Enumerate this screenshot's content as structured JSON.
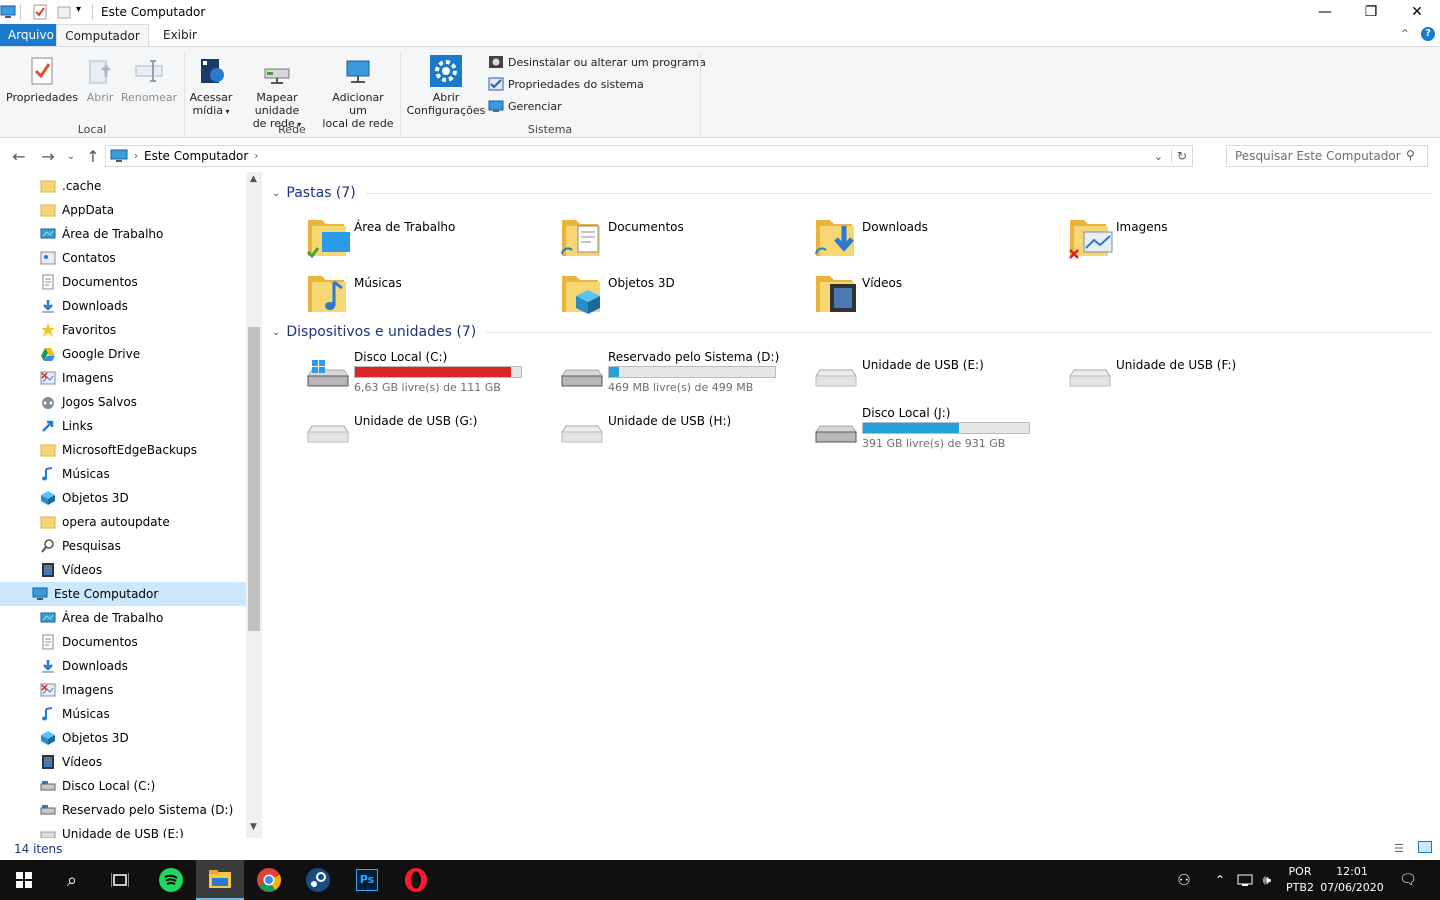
{
  "window": {
    "title": "Este Computador",
    "minimize": "—",
    "maximize": "❐",
    "close": "✕"
  },
  "ribbon_tabs": {
    "file": "Arquivo",
    "computer": "Computador",
    "view": "Exibir"
  },
  "ribbon": {
    "properties": "Propriedades",
    "open": "Abrir",
    "rename": "Renomear",
    "access_media_1": "Acessar",
    "access_media_2": "mídia",
    "map_drive_1": "Mapear unidade",
    "map_drive_2": "de rede",
    "add_location_1": "Adicionar um",
    "add_location_2": "local de rede",
    "open_settings_1": "Abrir",
    "open_settings_2": "Configurações",
    "uninstall": "Desinstalar ou alterar um programa",
    "system_properties": "Propriedades do sistema",
    "manage": "Gerenciar",
    "group_local": "Local",
    "group_network": "Rede",
    "group_system": "Sistema"
  },
  "address": {
    "path": "Este Computador",
    "search_placeholder": "Pesquisar Este Computador"
  },
  "nav_items": [
    {
      "label": ".cache",
      "icon": "folder-icon"
    },
    {
      "label": "AppData",
      "icon": "folder-icon"
    },
    {
      "label": "Área de Trabalho",
      "icon": "desktop-icon"
    },
    {
      "label": "Contatos",
      "icon": "contacts-icon"
    },
    {
      "label": "Documentos",
      "icon": "documents-icon"
    },
    {
      "label": "Downloads",
      "icon": "downloads-icon"
    },
    {
      "label": "Favoritos",
      "icon": "star-icon"
    },
    {
      "label": "Google Drive",
      "icon": "google-drive-icon"
    },
    {
      "label": "Imagens",
      "icon": "pictures-icon"
    },
    {
      "label": "Jogos Salvos",
      "icon": "saved-games-icon"
    },
    {
      "label": "Links",
      "icon": "links-icon"
    },
    {
      "label": "MicrosoftEdgeBackups",
      "icon": "folder-icon"
    },
    {
      "label": "Músicas",
      "icon": "music-icon"
    },
    {
      "label": "Objetos 3D",
      "icon": "3d-objects-icon"
    },
    {
      "label": "opera autoupdate",
      "icon": "folder-icon"
    },
    {
      "label": "Pesquisas",
      "icon": "search-icon"
    },
    {
      "label": "Vídeos",
      "icon": "videos-icon"
    },
    {
      "label": "Este Computador",
      "icon": "computer-icon"
    },
    {
      "label": "Área de Trabalho",
      "icon": "desktop-icon"
    },
    {
      "label": "Documentos",
      "icon": "documents-icon"
    },
    {
      "label": "Downloads",
      "icon": "downloads-icon"
    },
    {
      "label": "Imagens",
      "icon": "pictures-icon"
    },
    {
      "label": "Músicas",
      "icon": "music-icon"
    },
    {
      "label": "Objetos 3D",
      "icon": "3d-objects-icon"
    },
    {
      "label": "Vídeos",
      "icon": "videos-icon"
    },
    {
      "label": "Disco Local (C:)",
      "icon": "drive-icon"
    },
    {
      "label": "Reservado pelo Sistema (D:)",
      "icon": "drive-icon"
    },
    {
      "label": "Unidade de USB (E:)",
      "icon": "usb-drive-icon"
    }
  ],
  "sections": {
    "folders": "Pastas (7)",
    "devices": "Dispositivos e unidades (7)"
  },
  "folders": [
    {
      "label": "Área de Trabalho"
    },
    {
      "label": "Documentos"
    },
    {
      "label": "Downloads"
    },
    {
      "label": "Imagens"
    },
    {
      "label": "Músicas"
    },
    {
      "label": "Objetos 3D"
    },
    {
      "label": "Vídeos"
    }
  ],
  "drives": [
    {
      "label": "Disco Local (C:)",
      "space": "6,63 GB livre(s) de 111 GB",
      "used_fraction": 0.94,
      "critical": true
    },
    {
      "label": "Reservado pelo Sistema (D:)",
      "space": "469 MB livre(s) de 499 MB",
      "used_fraction": 0.06,
      "critical": false
    },
    {
      "label": "Unidade de USB (E:)"
    },
    {
      "label": "Unidade de USB (F:)"
    },
    {
      "label": "Unidade de USB (G:)"
    },
    {
      "label": "Unidade de USB (H:)"
    },
    {
      "label": "Disco Local (J:)",
      "space": "391 GB livre(s) de 931 GB",
      "used_fraction": 0.58,
      "critical": false
    }
  ],
  "status": {
    "count": "14 itens"
  },
  "taskbar": {
    "lang_1": "POR",
    "lang_2": "PTB2",
    "time": "12:01",
    "date": "07/06/2020"
  },
  "colors": {
    "accent": "#1979ca",
    "progress_blue": "#26a0da",
    "progress_red": "#da2626",
    "section_header": "#1e3287",
    "taskbar": "#101010"
  }
}
